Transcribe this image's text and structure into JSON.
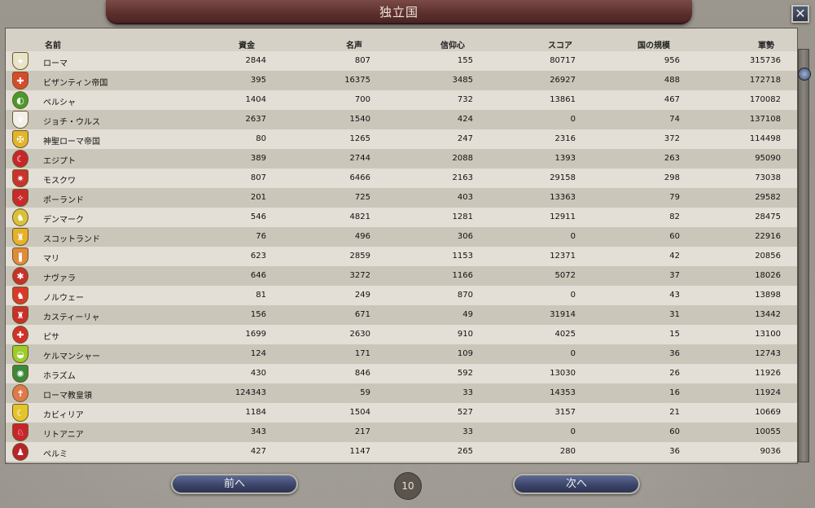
{
  "window": {
    "title": "独立国",
    "close_label": "✕"
  },
  "columns": [
    "名前",
    "資金",
    "名声",
    "信仰心",
    "スコア",
    "国の規模",
    "軍勢"
  ],
  "rows": [
    {
      "name": "ローマ",
      "gold": "2844",
      "prestige": "807",
      "piety": "155",
      "score": "80717",
      "size": "956",
      "army": "315736",
      "color": "#e9e4c8",
      "glyph": "✦"
    },
    {
      "name": "ビザンティン帝国",
      "gold": "395",
      "prestige": "16375",
      "piety": "3485",
      "score": "26927",
      "size": "488",
      "army": "172718",
      "color": "#d84a2a",
      "glyph": "✚"
    },
    {
      "name": "ペルシャ",
      "gold": "1404",
      "prestige": "700",
      "piety": "732",
      "score": "13861",
      "size": "467",
      "army": "170082",
      "color": "#4a9a2a",
      "glyph": "◐"
    },
    {
      "name": "ジョチ・ウルス",
      "gold": "2637",
      "prestige": "1540",
      "piety": "424",
      "score": "0",
      "size": "74",
      "army": "137108",
      "color": "#f2efe9",
      "glyph": "♆"
    },
    {
      "name": "神聖ローマ帝国",
      "gold": "80",
      "prestige": "1265",
      "piety": "247",
      "score": "2316",
      "size": "372",
      "army": "114498",
      "color": "#e2b62a",
      "glyph": "✠"
    },
    {
      "name": "エジプト",
      "gold": "389",
      "prestige": "2744",
      "piety": "2088",
      "score": "1393",
      "size": "263",
      "army": "95090",
      "color": "#c8252a",
      "glyph": "☾"
    },
    {
      "name": "モスクワ",
      "gold": "807",
      "prestige": "6466",
      "piety": "2163",
      "score": "29158",
      "size": "298",
      "army": "73038",
      "color": "#c9342c",
      "glyph": "✷"
    },
    {
      "name": "ポーランド",
      "gold": "201",
      "prestige": "725",
      "piety": "403",
      "score": "13363",
      "size": "79",
      "army": "29582",
      "color": "#c92a2a",
      "glyph": "✧"
    },
    {
      "name": "デンマーク",
      "gold": "546",
      "prestige": "4821",
      "piety": "1281",
      "score": "12911",
      "size": "82",
      "army": "28475",
      "color": "#d9c23a",
      "glyph": "♞"
    },
    {
      "name": "スコットランド",
      "gold": "76",
      "prestige": "496",
      "piety": "306",
      "score": "0",
      "size": "60",
      "army": "22916",
      "color": "#e7b12a",
      "glyph": "♜"
    },
    {
      "name": "マリ",
      "gold": "623",
      "prestige": "2859",
      "piety": "1153",
      "score": "12371",
      "size": "42",
      "army": "20856",
      "color": "#e28a3a",
      "glyph": "❚"
    },
    {
      "name": "ナヴァラ",
      "gold": "646",
      "prestige": "3272",
      "piety": "1166",
      "score": "5072",
      "size": "37",
      "army": "18026",
      "color": "#c8312a",
      "glyph": "✱"
    },
    {
      "name": "ノルウェー",
      "gold": "81",
      "prestige": "249",
      "piety": "870",
      "score": "0",
      "size": "43",
      "army": "13898",
      "color": "#d83a2a",
      "glyph": "♞"
    },
    {
      "name": "カスティーリャ",
      "gold": "156",
      "prestige": "671",
      "piety": "49",
      "score": "31914",
      "size": "31",
      "army": "13442",
      "color": "#c8302a",
      "glyph": "♜"
    },
    {
      "name": "ピサ",
      "gold": "1699",
      "prestige": "2630",
      "piety": "910",
      "score": "4025",
      "size": "15",
      "army": "13100",
      "color": "#d2312a",
      "glyph": "✚"
    },
    {
      "name": "ケルマンシャー",
      "gold": "124",
      "prestige": "171",
      "piety": "109",
      "score": "0",
      "size": "36",
      "army": "12743",
      "color": "#9ccd2a",
      "glyph": "◒"
    },
    {
      "name": "ホラズム",
      "gold": "430",
      "prestige": "846",
      "piety": "592",
      "score": "13030",
      "size": "26",
      "army": "11926",
      "color": "#3a8a3a",
      "glyph": "✺"
    },
    {
      "name": "ローマ教皇領",
      "gold": "124343",
      "prestige": "59",
      "piety": "33",
      "score": "14353",
      "size": "16",
      "army": "11924",
      "color": "#e07a4a",
      "glyph": "✝"
    },
    {
      "name": "カビィリア",
      "gold": "1184",
      "prestige": "1504",
      "piety": "527",
      "score": "3157",
      "size": "21",
      "army": "10669",
      "color": "#e3c42a",
      "glyph": "☾"
    },
    {
      "name": "リトアニア",
      "gold": "343",
      "prestige": "217",
      "piety": "33",
      "score": "0",
      "size": "60",
      "army": "10055",
      "color": "#c8252a",
      "glyph": "♘"
    },
    {
      "name": "ペルミ",
      "gold": "427",
      "prestige": "1147",
      "piety": "265",
      "score": "280",
      "size": "36",
      "army": "9036",
      "color": "#b8242a",
      "glyph": "♟"
    }
  ],
  "footer": {
    "prev_label": "前へ",
    "next_label": "次へ",
    "page": "10"
  }
}
